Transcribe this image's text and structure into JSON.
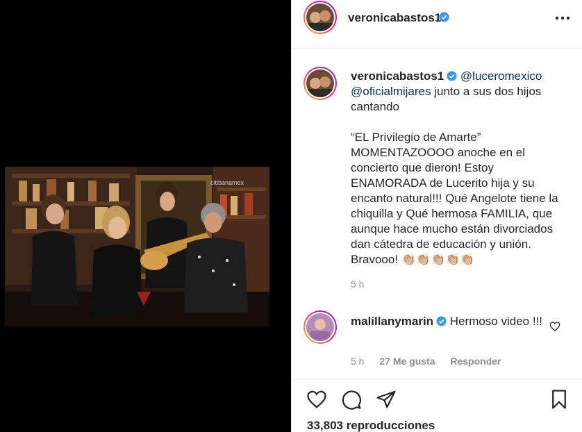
{
  "header": {
    "username": "veronicabastos1",
    "more_label": "more-options"
  },
  "video": {
    "watermark": "citibanamex"
  },
  "caption": {
    "username": "veronicabastos1",
    "mention1": "@luceromexico",
    "mention2": "@oficialmijares",
    "text1": " junto a sus dos hijos cantando",
    "text2": "“EL Privilegio de Amarte” MOMENTAZOOOO anoche en el concierto que dieron! Estoy ENAMORADA de Lucerito hija y su encanto natural!!! Qué Angelote tiene la chiquilla y Qué hermosa FAMILIA, que aunque hace mucho están divorciados dan cátedra de educación y unión. Bravooo! 👏🏼👏🏼👏🏼👏🏼👏🏼",
    "time": "5 h"
  },
  "comment": {
    "username": "malillanymarin",
    "text": "Hermoso video !!!",
    "time": "5 h",
    "likes": "27 Me gusta",
    "reply": "Responder"
  },
  "footer": {
    "views": "33,803 reproducciones"
  },
  "icons": {
    "like": "heart-icon",
    "comment": "comment-icon",
    "share": "send-icon",
    "save": "bookmark-icon",
    "verified": "verified-badge-icon"
  },
  "colors": {
    "verified": "#3897f0",
    "mention": "#00376b",
    "secondary_text": "#8e8e8e"
  }
}
